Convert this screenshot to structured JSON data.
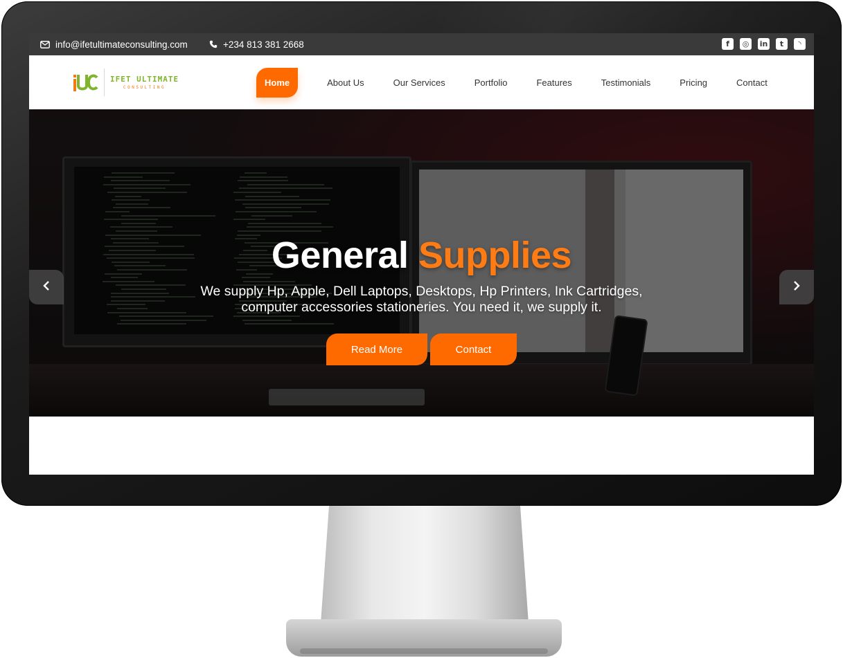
{
  "topbar": {
    "email": "info@ifetultimateconsulting.com",
    "phone": "+234 813 381 2668",
    "socials": [
      {
        "icon": "facebook-icon",
        "glyph": "f"
      },
      {
        "icon": "instagram-icon",
        "glyph": "◎"
      },
      {
        "icon": "linkedin-icon",
        "glyph": "in"
      },
      {
        "icon": "twitter-icon",
        "glyph": "t"
      },
      {
        "icon": "rss-icon",
        "glyph": "◝"
      }
    ]
  },
  "logo": {
    "mark": "IUC",
    "title": "IFET ULTIMATE",
    "subtitle": "CONSULTING"
  },
  "nav": {
    "items": [
      "Home",
      "About Us",
      "Our Services",
      "Portfolio",
      "Features",
      "Testimonials",
      "Pricing",
      "Contact"
    ],
    "active": "Home"
  },
  "hero": {
    "title_main": "General",
    "title_accent": "Supplies",
    "text": "We supply Hp, Apple, Dell Laptops, Desktops, Hp Printers, Ink Cartridges, computer accessories stationeries. You need it, we supply it.",
    "buttons": [
      "Read More",
      "Contact"
    ]
  },
  "colors": {
    "accent": "#ff6a00",
    "topbar_bg": "#3a3a3a",
    "logo_green": "#7fb42c",
    "logo_orange": "#f07a16"
  }
}
